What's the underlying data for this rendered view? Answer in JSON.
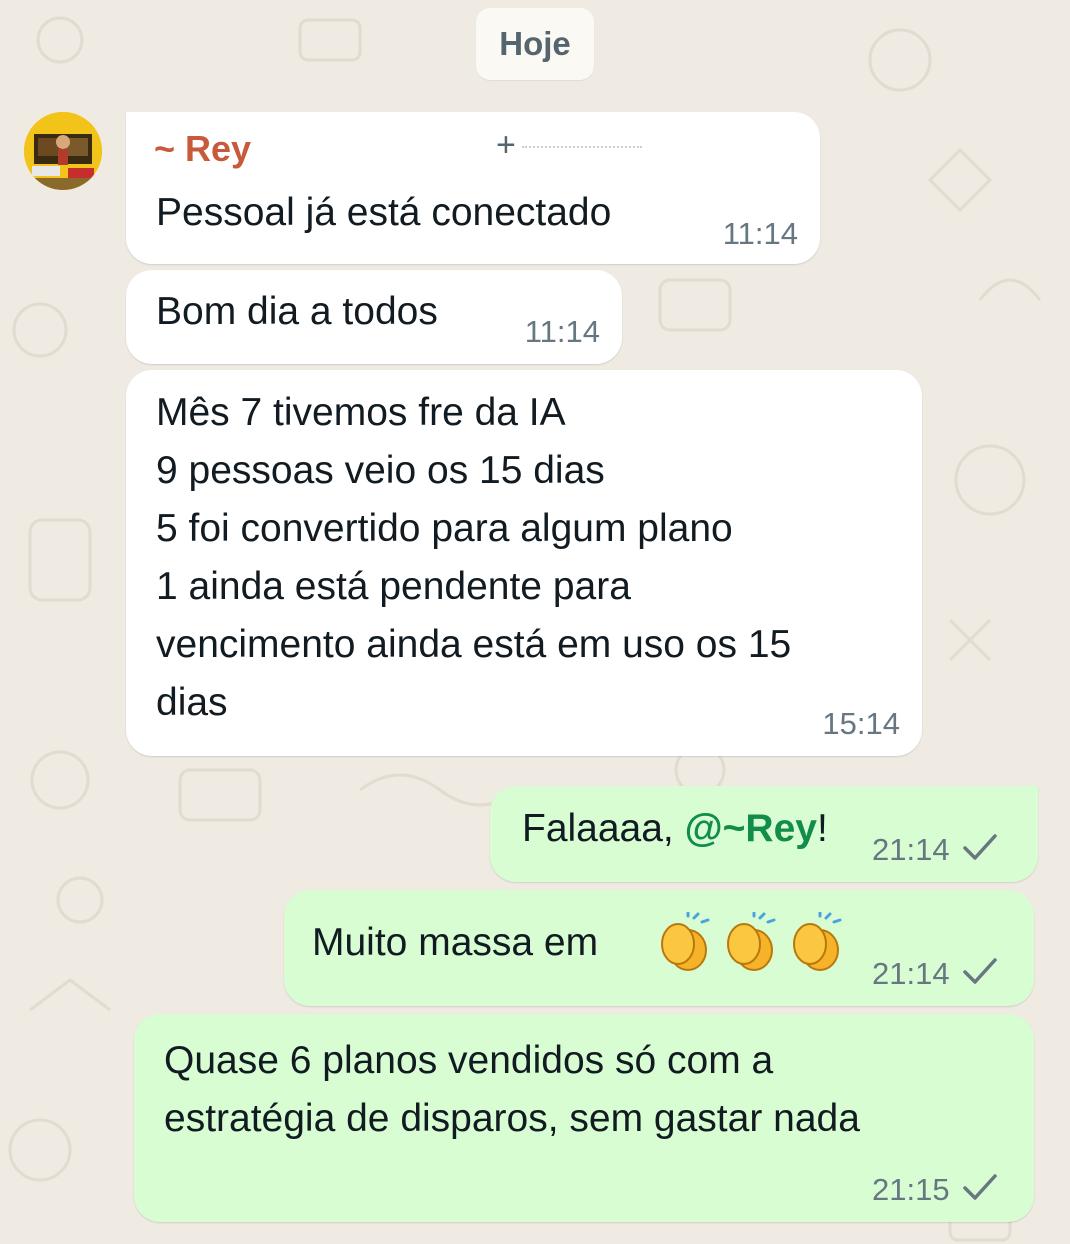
{
  "date_divider": "Hoje",
  "contact": {
    "name": "~ Rey",
    "phone_masked": "+",
    "avatar": "avatar-photo"
  },
  "incoming": [
    {
      "text": "Pessoal já está conectado",
      "time": "11:14"
    },
    {
      "text": "Bom dia a todos",
      "time": "11:14"
    },
    {
      "text": "Mês 7 tivemos fre da IA\n9 pessoas veio os 15 dias\n5 foi convertido para algum plano\n1 ainda está pendente para\nvencimento ainda está em uso os 15\ndias",
      "time": "15:14"
    }
  ],
  "outgoing": [
    {
      "prefix": "Falaaaa, ",
      "mention": "@~Rey",
      "suffix": "!",
      "time": "21:14",
      "status_icon": "single-check-icon"
    },
    {
      "text": "Muito massa em",
      "emojis": [
        "clapping-hands-icon",
        "clapping-hands-icon",
        "clapping-hands-icon"
      ],
      "time": "21:14",
      "status_icon": "single-check-icon"
    },
    {
      "text": "Quase 6 planos vendidos só com a\nestratégia de disparos, sem gastar nada",
      "time": "21:15",
      "status_icon": "single-check-icon"
    }
  ],
  "colors": {
    "background": "#efeae2",
    "incoming_bubble": "#ffffff",
    "outgoing_bubble": "#d9fdd3",
    "sender_name": "#c8593a",
    "mention": "#128c4a"
  }
}
